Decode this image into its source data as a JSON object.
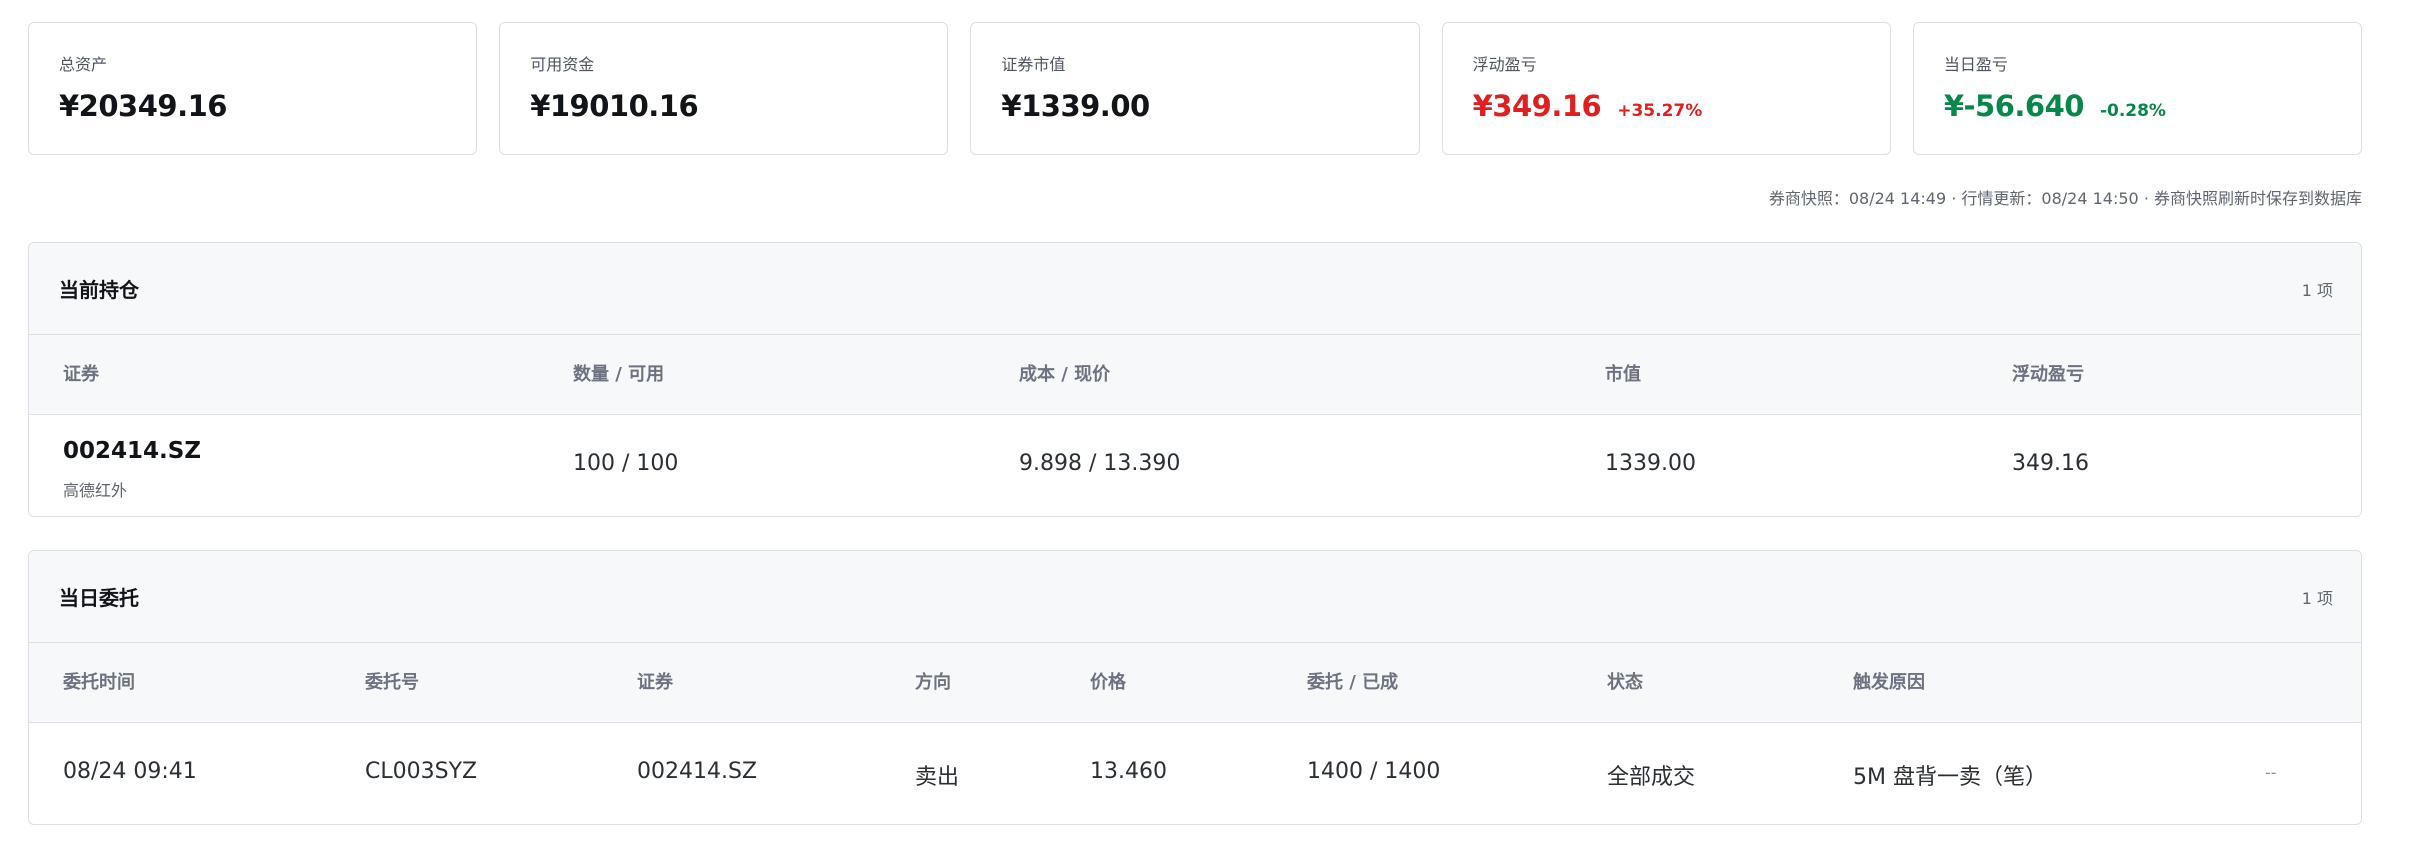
{
  "stats": [
    {
      "label": "总资产",
      "value": "¥20349.16",
      "change": "",
      "tone": "neutral"
    },
    {
      "label": "可用资金",
      "value": "¥19010.16",
      "change": "",
      "tone": "neutral"
    },
    {
      "label": "证券市值",
      "value": "¥1339.00",
      "change": "",
      "tone": "neutral"
    },
    {
      "label": "浮动盈亏",
      "value": "¥349.16",
      "change": "+35.27%",
      "tone": "up"
    },
    {
      "label": "当日盈亏",
      "value": "¥-56.640",
      "change": "-0.28%",
      "tone": "down"
    }
  ],
  "snapshot_note": "券商快照：08/24 14:49 · 行情更新：08/24 14:50 · 券商快照刷新时保存到数据库",
  "positions": {
    "title": "当前持仓",
    "count": "1 项",
    "columns": [
      "证券",
      "数量 / 可用",
      "成本 / 现价",
      "市值",
      "浮动盈亏"
    ],
    "rows": [
      {
        "code": "002414.SZ",
        "name": "高德红外",
        "qty": "100 / 100",
        "cost_price": "9.898 / 13.390",
        "market_value": "1339.00",
        "pnl": "349.16"
      }
    ]
  },
  "orders": {
    "title": "当日委托",
    "count": "1 项",
    "columns": [
      "委托时间",
      "委托号",
      "证券",
      "方向",
      "价格",
      "委托 / 已成",
      "状态",
      "触发原因"
    ],
    "rows": [
      {
        "time": "08/24 09:41",
        "order_no": "CL003SYZ",
        "code": "002414.SZ",
        "side": "卖出",
        "price": "13.460",
        "qty": "1400 / 1400",
        "status": "全部成交",
        "reason": "5M 盘背一卖（笔）",
        "extra": "--"
      }
    ]
  },
  "colors": {
    "up": "#e02020",
    "down": "#07884a",
    "border": "#dcdfe4",
    "header_bg": "#f7f8fa"
  }
}
